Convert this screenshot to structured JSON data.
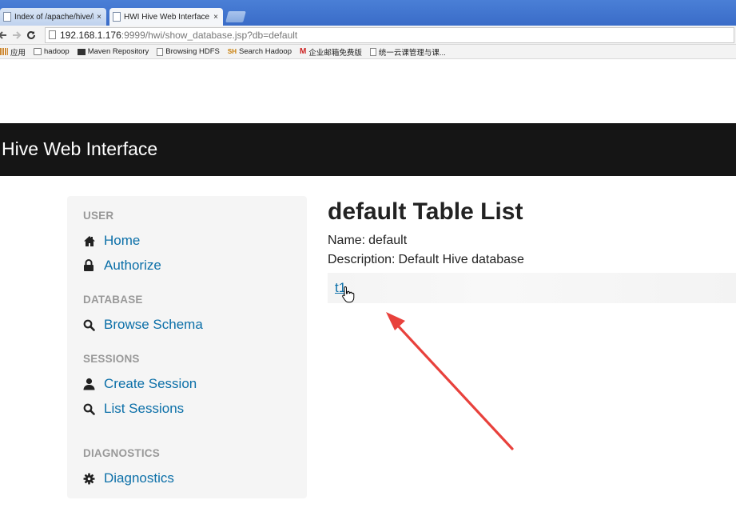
{
  "browser": {
    "tabs": [
      {
        "title": "Index of /apache/hive/l",
        "close": "×",
        "active": false
      },
      {
        "title": "HWI Hive Web Interface",
        "close": "×",
        "active": true
      }
    ],
    "url": {
      "host": "192.168.1.176",
      "rest": ":9999/hwi/show_database.jsp?db=default"
    },
    "bookmarks": [
      {
        "icon": "apps-icon",
        "label": "应用"
      },
      {
        "icon": "folder-icon",
        "label": "hadoop"
      },
      {
        "icon": "maven-icon",
        "label": "Maven Repository"
      },
      {
        "icon": "page-icon",
        "label": "Browsing HDFS"
      },
      {
        "icon": "search-hadoop-icon",
        "label": "Search Hadoop",
        "badge": "SH"
      },
      {
        "icon": "gmail-icon",
        "label": "企业邮箱免费版",
        "badge": "M"
      },
      {
        "icon": "page-icon",
        "label": "统一云课管理与课..."
      }
    ]
  },
  "navbar": {
    "brand": "Hive Web Interface"
  },
  "sidebar": {
    "sections": [
      {
        "header": "USER",
        "items": [
          {
            "label": "Home",
            "icon": "home-icon"
          },
          {
            "label": "Authorize",
            "icon": "lock-icon"
          }
        ]
      },
      {
        "header": "DATABASE",
        "items": [
          {
            "label": "Browse Schema",
            "icon": "search-icon"
          }
        ]
      },
      {
        "header": "SESSIONS",
        "items": [
          {
            "label": "Create Session",
            "icon": "user-icon"
          },
          {
            "label": "List Sessions",
            "icon": "search-icon"
          }
        ]
      },
      {
        "header": "DIAGNOSTICS",
        "items": [
          {
            "label": "Diagnostics",
            "icon": "gear-icon"
          }
        ]
      }
    ]
  },
  "main": {
    "title": "default Table List",
    "name_label": "Name:",
    "name_value": "default",
    "description_label": "Description:",
    "description_value": "Default Hive database",
    "tables": [
      "t1"
    ]
  },
  "colors": {
    "navbar_bg": "#151515",
    "link": "#0b6fa8",
    "annotation_arrow": "#e8413c"
  }
}
